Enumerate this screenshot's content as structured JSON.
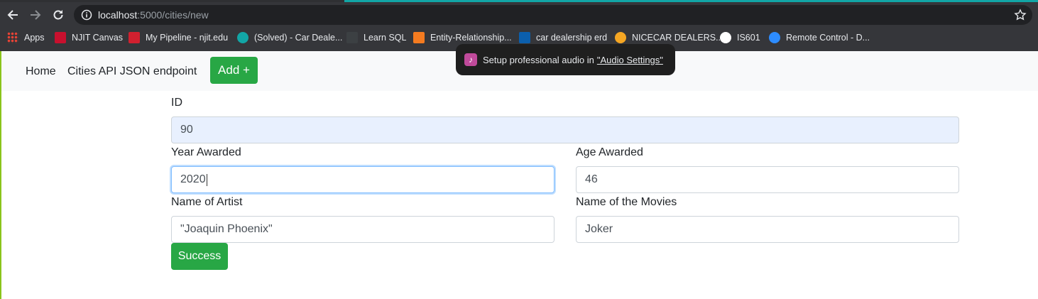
{
  "browser": {
    "url_host": "localhost",
    "url_path": ":5000/cities/new",
    "bookmarks": [
      {
        "label": "Apps",
        "color": "#ea4335"
      },
      {
        "label": "NJIT Canvas",
        "color": "#c8102e"
      },
      {
        "label": "My Pipeline - njit.edu",
        "color": "#d1202f"
      },
      {
        "label": "(Solved) - Car Deale...",
        "color": "#12a6a6"
      },
      {
        "label": "Learn SQL",
        "color": "#3c4043"
      },
      {
        "label": "Entity-Relationship...",
        "color": "#f47b20"
      },
      {
        "label": "car dealership erd",
        "color": "#0b5fad"
      },
      {
        "label": "NICECAR DEALERS...",
        "color": "#f5a623"
      },
      {
        "label": "IS601",
        "color": "#ffffff"
      },
      {
        "label": "Remote Control - D...",
        "color": "#2d8cff"
      }
    ]
  },
  "toast": {
    "text": "Setup professional audio in",
    "link": "\"Audio Settings\""
  },
  "navbar": {
    "home": "Home",
    "api": "Cities API JSON endpoint",
    "add": "Add +"
  },
  "form": {
    "id_label": "ID",
    "id_value": "90",
    "year_label": "Year Awarded",
    "year_value": "2020",
    "age_label": "Age Awarded",
    "age_value": "46",
    "artist_label": "Name of Artist",
    "artist_value": "\"Joaquin Phoenix\"",
    "movie_label": "Name of the Movies",
    "movie_value": "Joker",
    "submit": "Success"
  },
  "colors": {
    "success_green": "#28a745",
    "chrome_dark": "#35363a",
    "accent_teal": "#12a6a6"
  }
}
